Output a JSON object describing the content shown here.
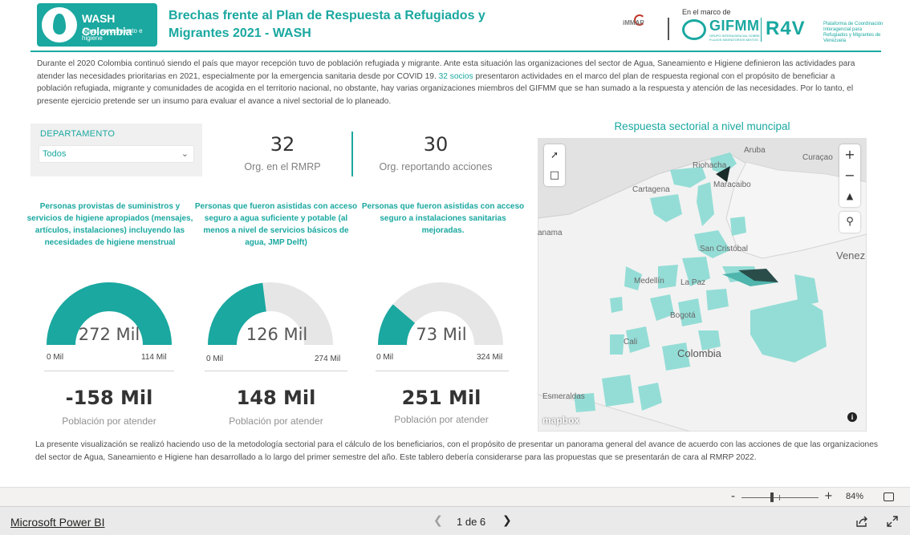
{
  "header": {
    "logo_title": "WASH Colombia",
    "logo_subtitle": "Agua, saneamiento e higiene",
    "title": "Brechas frente al Plan de Respuesta a Refugiados y Migrantes 2021 - WASH",
    "immap": "iMMAP",
    "marco": "En el marco de",
    "gifmm": "GIFMM",
    "gifmm_sub": "GRUPO INTERAGENCIAL SOBRE FLUJOS MIGRATORIOS MIXTOS",
    "r4v": "R4V",
    "r4v_sub": "Plataforma de Coordinación Interagencial para Refugiados y Migrantes de Venezuela"
  },
  "intro": {
    "text_before": "Durante el 2020 Colombia continuó siendo el país que mayor recepción tuvo de población refugiada y migrante. Ante esta situación las organizaciones del sector de Agua, Saneamiento e Higiene definieron las actividades para atender las necesidades prioritarias en 2021, especialmente por la emergencia sanitaria desde por COVID 19. ",
    "highlight": "32 socios",
    "text_after": " presentaron actividades en el marco del plan de respuesta regional con el propósito de beneficiar a población refugiada, migrante y comunidades de acogida en el territorio nacional, no obstante, hay varias organizaciones  miembros del GIFMM que se han sumado a la respuesta y atención de las necesidades. Por lo tanto, el presente ejercicio pretende ser un insumo para evaluar el avance a nivel sectorial de lo planeado."
  },
  "slicer": {
    "label": "DEPARTAMENTO",
    "value": "Todos"
  },
  "kpis": [
    {
      "value": "32",
      "label": "Org. en el RMRP"
    },
    {
      "value": "30",
      "label": "Org. reportando acciones"
    }
  ],
  "gauges": [
    {
      "title": "Personas provistas de suministros y servicios de higiene apropiados (mensajes, artículos, instalaciones) incluyendo las necesidades de higiene menstrual",
      "value_label": "272 Mil",
      "min": "0 Mil",
      "max": "114 Mil",
      "fill_fraction": 1.0,
      "gap_value": "-158 Mil",
      "gap_label": "Población por atender"
    },
    {
      "title": "Personas que fueron asistidas con acceso seguro a agua suficiente y potable (al menos a nivel de servicios básicos de agua, JMP Delft)",
      "value_label": "126 Mil",
      "min": "0 Mil",
      "max": "274 Mil",
      "fill_fraction": 0.46,
      "gap_value": "148 Mil",
      "gap_label": "Población por atender"
    },
    {
      "title": "Personas que fueron asistidas con acceso seguro a instalaciones sanitarias mejoradas.",
      "value_label": "73 Mil",
      "min": "0 Mil",
      "max": "324 Mil",
      "fill_fraction": 0.225,
      "gap_value": "251 Mil",
      "gap_label": "Población por atender"
    }
  ],
  "map": {
    "title": "Respuesta sectorial a nivel muncipal",
    "labels": {
      "aruba": "Aruba",
      "curacao": "Curaçao",
      "riohacha": "Riohacha",
      "maracaibo": "Maracaibo",
      "cartagena": "Cartagena",
      "panama": "anama",
      "san_cristobal": "San Cristóbal",
      "venez": "Venez",
      "medellin": "Medellín",
      "la_paz": "La Paz",
      "bogota": "Bogotá",
      "cali": "Cali",
      "colombia": "Colombia",
      "esmeraldas": "Esmeraldas"
    },
    "attribution": "mapbox",
    "colors": {
      "light": "#8fdcd5",
      "mid": "#4fb5ad",
      "dark": "#2a4d4a",
      "darkest": "#1b2b2a"
    }
  },
  "footnote": "La presente visualización se realizó haciendo uso de la metodología sectorial para el cálculo de los beneficiarios, con el propósito de presentar un panorama general del avance de acuerdo con las acciones de que las organizaciones del sector de Agua, Saneamiento e Higiene han desarrollado a lo largo del primer semestre del año. Este tablero debería considerarse para las propuestas que se presentarán de cara al RMRP 2022.",
  "zoom": {
    "level": "84%"
  },
  "footer": {
    "brand": "Microsoft Power BI",
    "page_info": "1 de 6"
  },
  "colors": {
    "accent": "#1aa8a0",
    "gauge_track": "#e6e6e6"
  }
}
